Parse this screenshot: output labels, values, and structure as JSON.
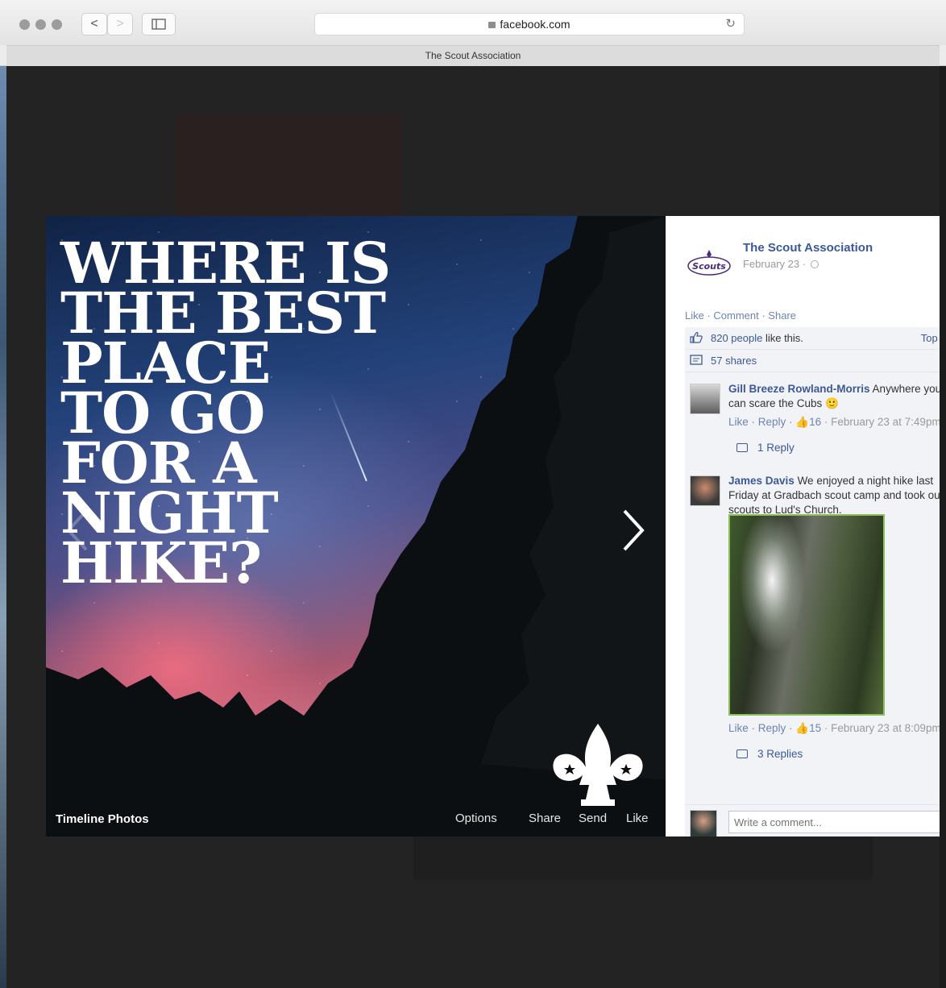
{
  "browser": {
    "url": "facebook.com",
    "tab_title": "The Scout Association",
    "back_glyph": "<",
    "forward_glyph": ">",
    "reload_glyph": "↻"
  },
  "viewer": {
    "headline_lines": [
      "WHERE IS",
      "THE BEST",
      "PLACE",
      "TO GO",
      "FOR A",
      "NIGHT",
      "HIKE?"
    ],
    "album": "Timeline Photos",
    "actions": {
      "options": "Options",
      "share": "Share",
      "send": "Send",
      "like": "Like"
    }
  },
  "post": {
    "page_name": "The Scout Association",
    "date": "February 23 ·",
    "logo_text": "Scouts",
    "actions": "Like · Comment · Share",
    "likes": {
      "count_text": "820 people",
      "suffix": " like this.",
      "sort": "Top Co"
    },
    "shares": "57 shares"
  },
  "comments": [
    {
      "author": "Gill Breeze Rowland-Morris",
      "text": " Anywhere you can scare the Cubs 🙂",
      "meta_actions": "Like · Reply · ",
      "likes": "16",
      "time": " · February 23 at 7:49pm",
      "replies": "1 Reply"
    },
    {
      "author": "James Davis",
      "text": " We enjoyed a night hike last Friday at Gradbach scout camp and took our scouts to Lud's Church.",
      "meta_actions": "Like · Reply · ",
      "likes": "15",
      "time": " · February 23 at 8:09pm",
      "replies": "3 Replies"
    }
  ],
  "composer": {
    "placeholder": "Write a comment..."
  },
  "colors": {
    "fb_blue": "#3b5998",
    "link_blue": "#6d84b4",
    "panel_bg": "#f2f3f7"
  }
}
